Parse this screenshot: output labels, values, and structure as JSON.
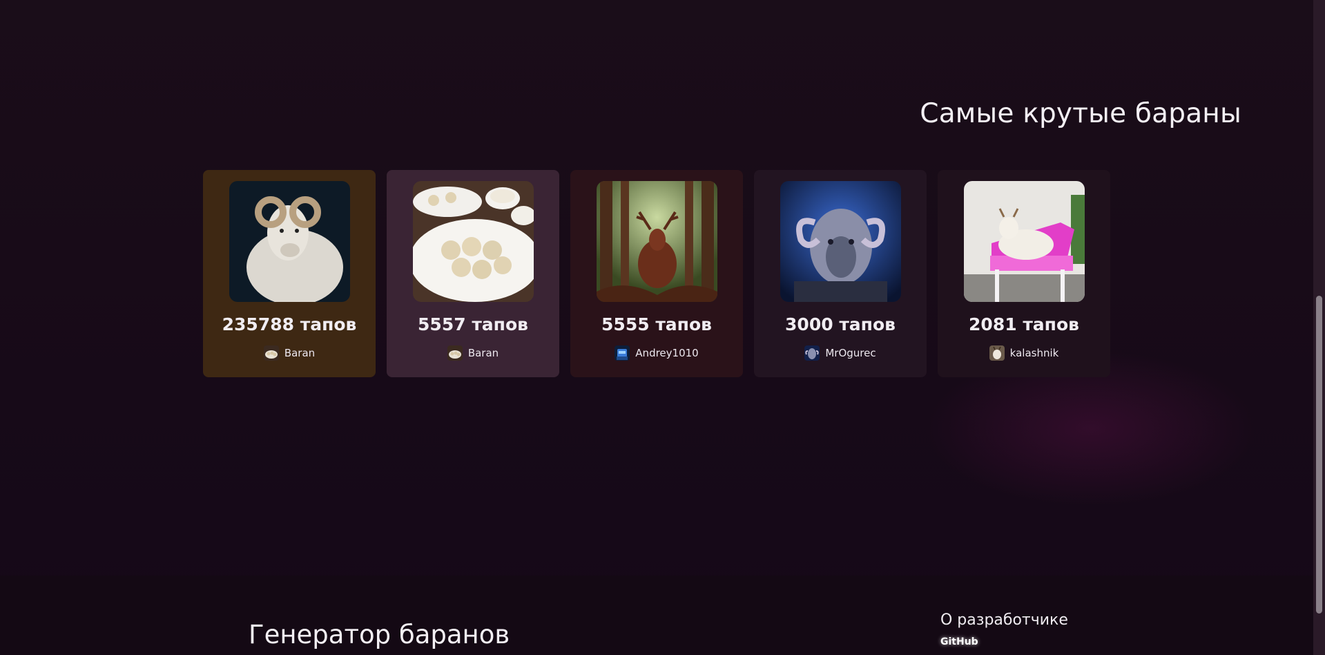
{
  "top_section": {
    "title": "Самые крутые бараны"
  },
  "cards": [
    {
      "taps": "235788 тапов",
      "owner": "Baran",
      "image_icon": "ram-image",
      "avatar_icon": "dumplings-avatar",
      "color": "#3e2813"
    },
    {
      "taps": "5557 тапов",
      "owner": "Baran",
      "image_icon": "dumplings-image",
      "avatar_icon": "dumplings-avatar",
      "color": "#3a2434"
    },
    {
      "taps": "5555 тапов",
      "owner": "Andrey1010",
      "image_icon": "deer-forest-image",
      "avatar_icon": "robot-avatar",
      "color": "#2a1219"
    },
    {
      "taps": "3000 тапов",
      "owner": "MrOgurec",
      "image_icon": "blue-ram-image",
      "avatar_icon": "blue-ram-avatar",
      "color": "#221421"
    },
    {
      "taps": "2081 тапов",
      "owner": "kalashnik",
      "image_icon": "goat-pink-chair-image",
      "avatar_icon": "goat-avatar",
      "color": "#1f111c"
    }
  ],
  "footer": {
    "title": "Генератор баранов",
    "about_label": "О разработчике",
    "github_label": "GitHub"
  }
}
